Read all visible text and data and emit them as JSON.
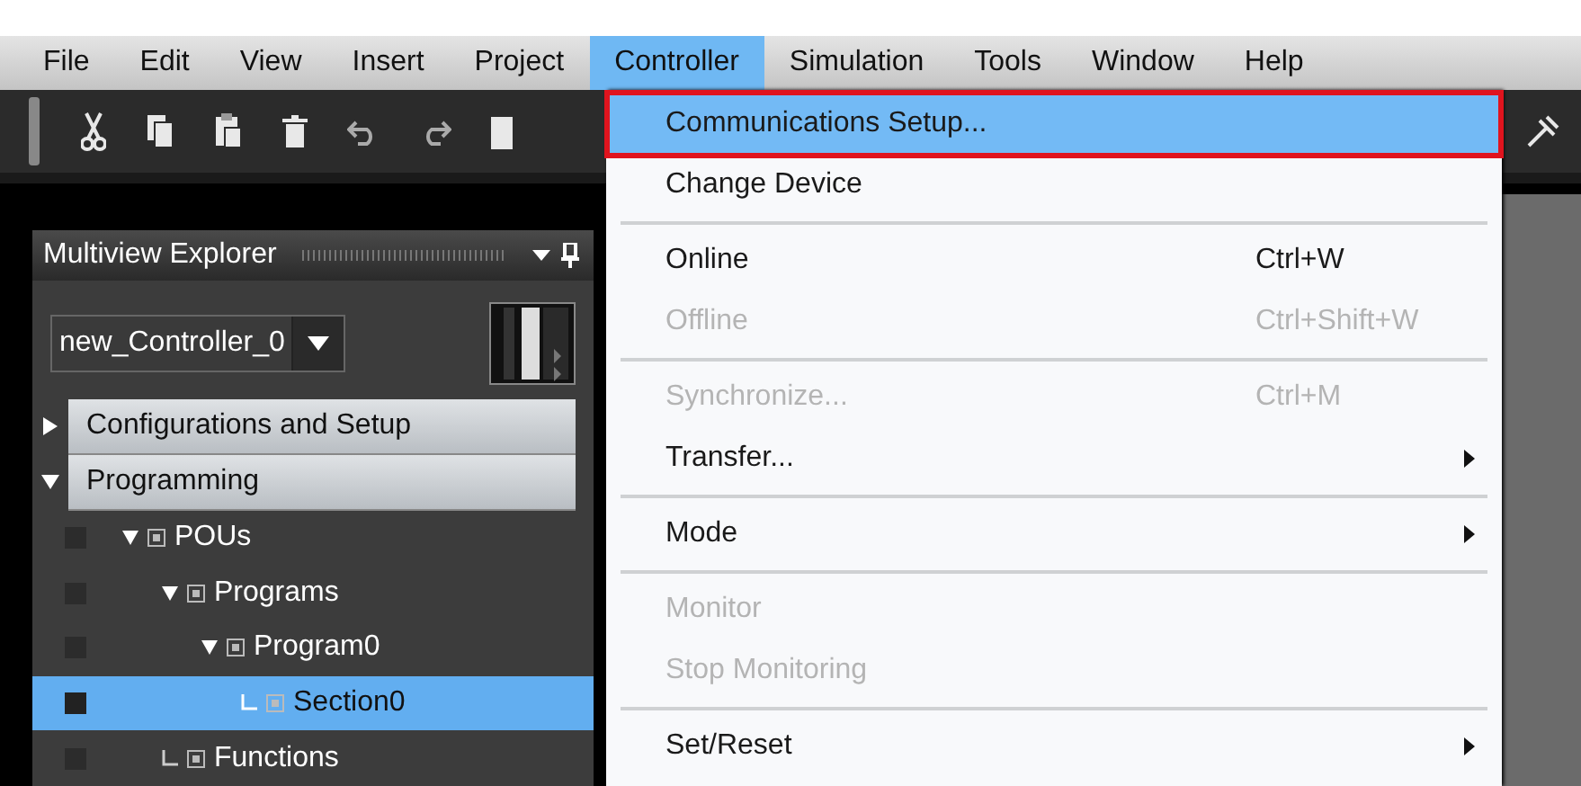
{
  "menubar": [
    {
      "label": "File",
      "selected": false
    },
    {
      "label": "Edit",
      "selected": false
    },
    {
      "label": "View",
      "selected": false
    },
    {
      "label": "Insert",
      "selected": false
    },
    {
      "label": "Project",
      "selected": false
    },
    {
      "label": "Controller",
      "selected": true
    },
    {
      "label": "Simulation",
      "selected": false
    },
    {
      "label": "Tools",
      "selected": false
    },
    {
      "label": "Window",
      "selected": false
    },
    {
      "label": "Help",
      "selected": false
    }
  ],
  "explorer": {
    "title": "Multiview Explorer",
    "device": {
      "value": "new_Controller_0"
    },
    "sections": [
      {
        "label": "Configurations and Setup",
        "expanded": false
      },
      {
        "label": "Programming",
        "expanded": true
      }
    ],
    "tree": [
      {
        "label": "POUs",
        "expanded": true,
        "selected": false,
        "children": [
          {
            "label": "Programs",
            "expanded": true,
            "selected": false,
            "children": [
              {
                "label": "Program0",
                "expanded": true,
                "selected": false,
                "children": [
                  {
                    "label": "Section0",
                    "selected": true
                  }
                ]
              }
            ]
          },
          {
            "label": "Functions",
            "selected": false
          }
        ]
      }
    ]
  },
  "menu": {
    "items": [
      {
        "kind": "item",
        "label": "Communications Setup...",
        "disabled": false,
        "selected": true,
        "outlined": true
      },
      {
        "kind": "item",
        "label": "Change Device",
        "disabled": false,
        "selected": false,
        "outlined": false
      },
      {
        "kind": "separator"
      },
      {
        "kind": "item",
        "label": "Online",
        "shortcut": "Ctrl+W",
        "disabled": false,
        "selected": false,
        "outlined": false
      },
      {
        "kind": "item",
        "label": "Offline",
        "shortcut": "Ctrl+Shift+W",
        "disabled": true,
        "selected": false,
        "outlined": false
      },
      {
        "kind": "separator"
      },
      {
        "kind": "item",
        "label": "Synchronize...",
        "shortcut": "Ctrl+M",
        "disabled": true,
        "selected": false,
        "outlined": false
      },
      {
        "kind": "item",
        "label": "Transfer...",
        "submenu": true,
        "disabled": false,
        "selected": false,
        "outlined": false
      },
      {
        "kind": "separator"
      },
      {
        "kind": "item",
        "label": "Mode",
        "submenu": true,
        "disabled": false,
        "selected": false,
        "outlined": false
      },
      {
        "kind": "separator"
      },
      {
        "kind": "item",
        "label": "Monitor",
        "disabled": true,
        "selected": false,
        "outlined": false
      },
      {
        "kind": "item",
        "label": "Stop Monitoring",
        "disabled": true,
        "selected": false,
        "outlined": false
      },
      {
        "kind": "separator"
      },
      {
        "kind": "item",
        "label": "Set/Reset",
        "submenu": true,
        "disabled": false,
        "selected": false,
        "outlined": false
      }
    ]
  }
}
